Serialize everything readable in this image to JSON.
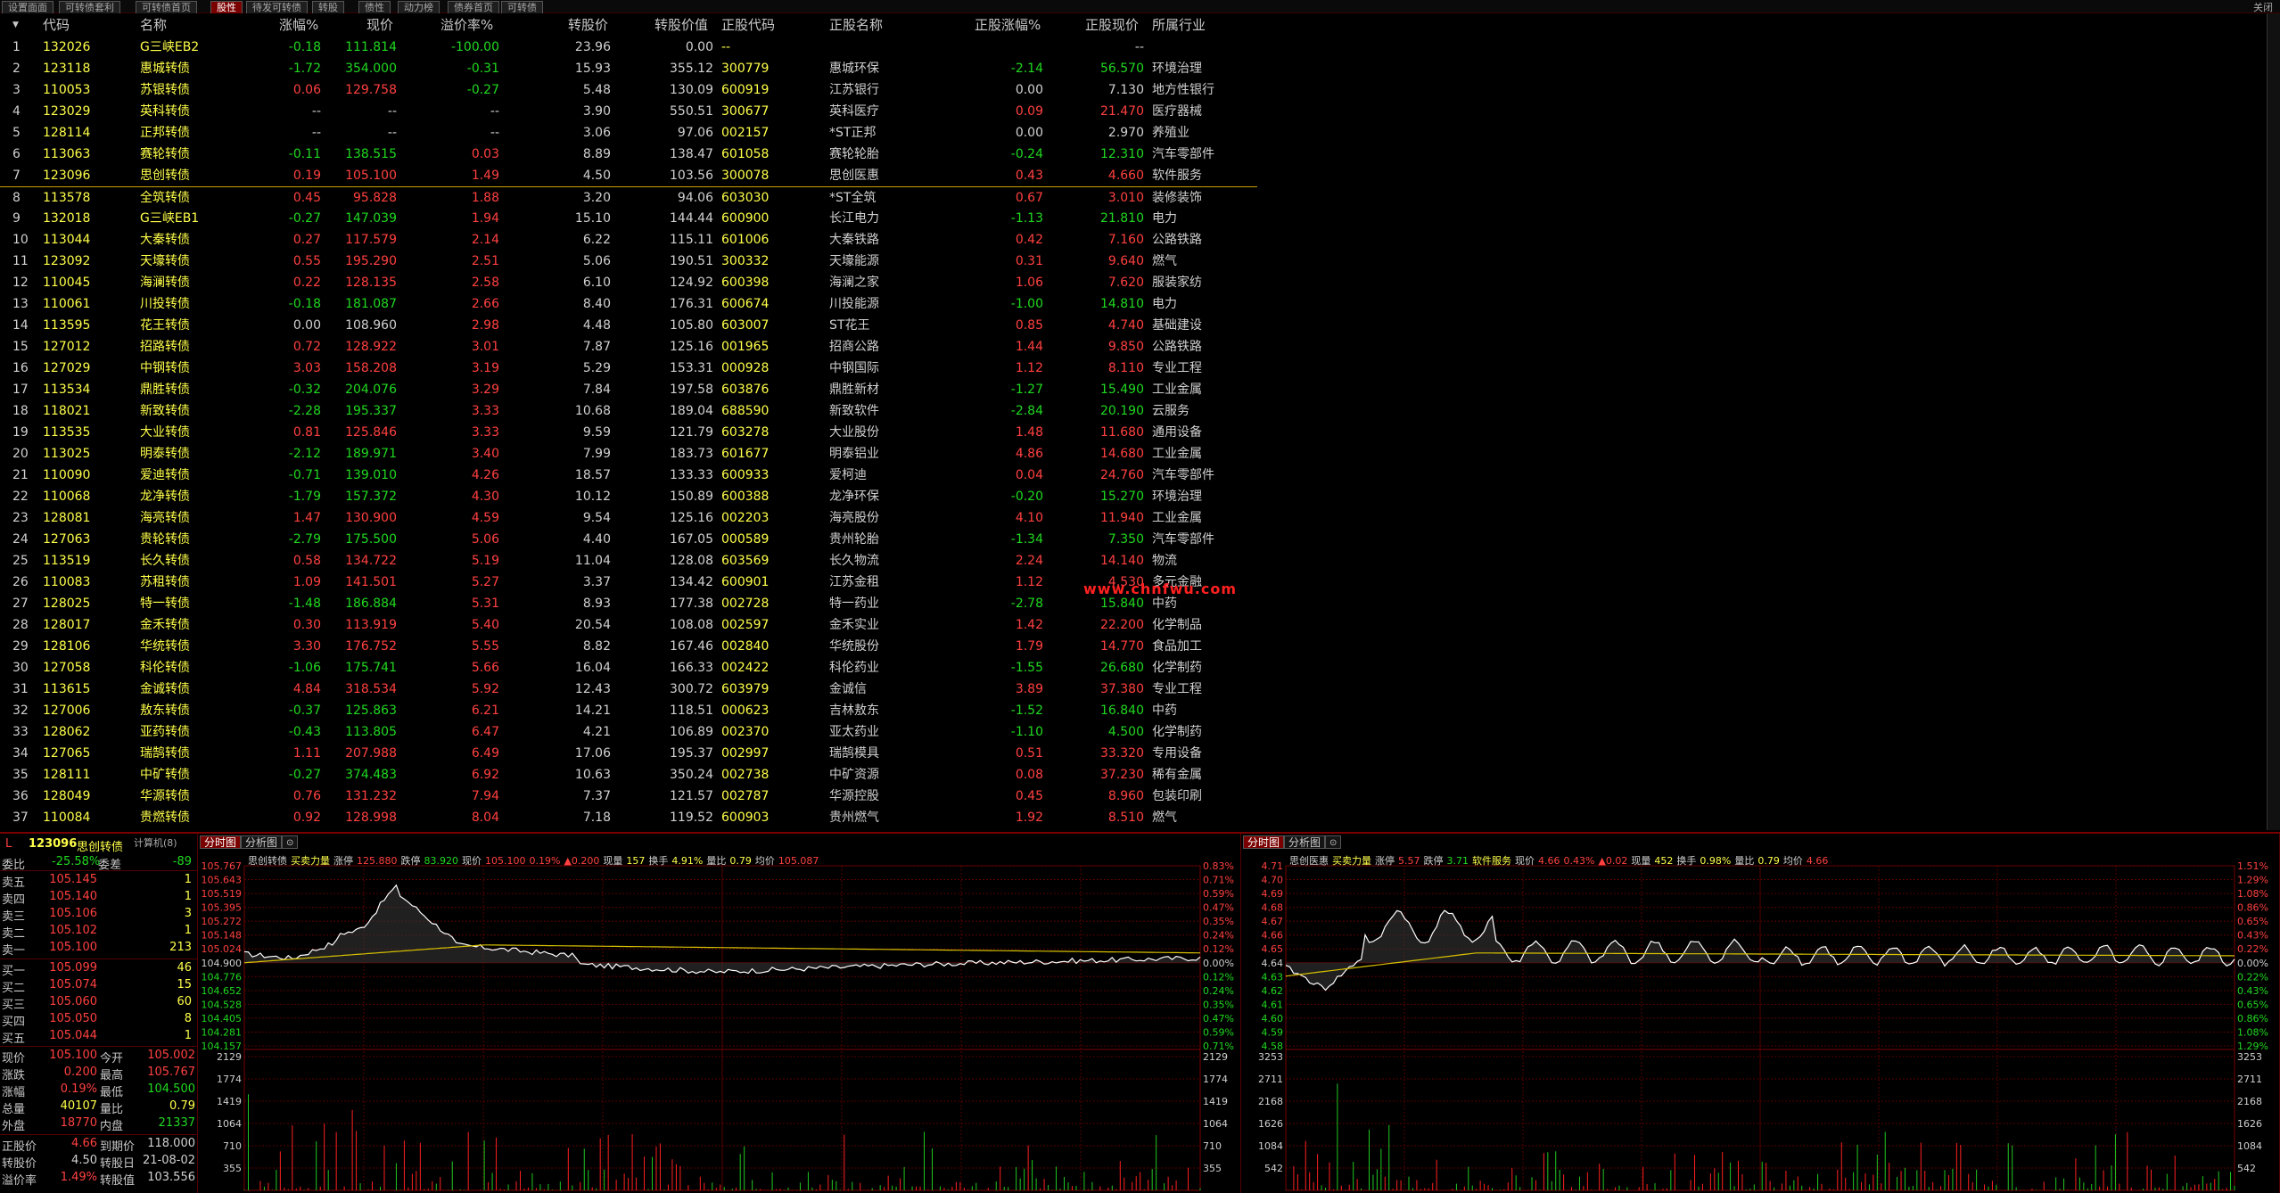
{
  "tabs": [
    "设置面面",
    "可转债套利",
    "可转债首页",
    "股性",
    "待发可转债",
    "转股",
    "债性",
    "动力榜",
    "债券首页",
    "可转债"
  ],
  "active_tab": 3,
  "close_label": "关闭",
  "headers": {
    "idx": "",
    "code": "代码",
    "name": "名称",
    "chg": "涨幅%",
    "price": "现价",
    "prem": "溢价率%",
    "conv_price": "转股价",
    "conv_value": "转股价值",
    "stock_code": "正股代码",
    "stock_name": "正股名称",
    "stock_chg": "正股涨幅%",
    "stock_price": "正股现价",
    "industry": "所属行业"
  },
  "rows": [
    [
      "1",
      "132026",
      "G三峡EB2",
      "-0.18",
      "111.814",
      "-100.00",
      "23.96",
      "0.00",
      "--",
      "",
      "",
      "--",
      ""
    ],
    [
      "2",
      "123118",
      "惠城转债",
      "-1.72",
      "354.000",
      "-0.31",
      "15.93",
      "355.12",
      "300779",
      "惠城环保",
      "-2.14",
      "56.570",
      "环境治理"
    ],
    [
      "3",
      "110053",
      "苏银转债",
      "0.06",
      "129.758",
      "-0.27",
      "5.48",
      "130.09",
      "600919",
      "江苏银行",
      "0.00",
      "7.130",
      "地方性银行"
    ],
    [
      "4",
      "123029",
      "英科转债",
      "--",
      "--",
      "--",
      "3.90",
      "550.51",
      "300677",
      "英科医疗",
      "0.09",
      "21.470",
      "医疗器械"
    ],
    [
      "5",
      "128114",
      "正邦转债",
      "--",
      "--",
      "--",
      "3.06",
      "97.06",
      "002157",
      "*ST正邦",
      "0.00",
      "2.970",
      "养殖业"
    ],
    [
      "6",
      "113063",
      "赛轮转债",
      "-0.11",
      "138.515",
      "0.03",
      "8.89",
      "138.47",
      "601058",
      "赛轮轮胎",
      "-0.24",
      "12.310",
      "汽车零部件"
    ],
    [
      "7",
      "123096",
      "思创转债",
      "0.19",
      "105.100",
      "1.49",
      "4.50",
      "103.56",
      "300078",
      "思创医惠",
      "0.43",
      "4.660",
      "软件服务"
    ],
    [
      "8",
      "113578",
      "全筑转债",
      "0.45",
      "95.828",
      "1.88",
      "3.20",
      "94.06",
      "603030",
      "*ST全筑",
      "0.67",
      "3.010",
      "装修装饰"
    ],
    [
      "9",
      "132018",
      "G三峡EB1",
      "-0.27",
      "147.039",
      "1.94",
      "15.10",
      "144.44",
      "600900",
      "长江电力",
      "-1.13",
      "21.810",
      "电力"
    ],
    [
      "10",
      "113044",
      "大秦转债",
      "0.27",
      "117.579",
      "2.14",
      "6.22",
      "115.11",
      "601006",
      "大秦铁路",
      "0.42",
      "7.160",
      "公路铁路"
    ],
    [
      "11",
      "123092",
      "天壕转债",
      "0.55",
      "195.290",
      "2.51",
      "5.06",
      "190.51",
      "300332",
      "天壕能源",
      "0.31",
      "9.640",
      "燃气"
    ],
    [
      "12",
      "110045",
      "海澜转债",
      "0.22",
      "128.135",
      "2.58",
      "6.10",
      "124.92",
      "600398",
      "海澜之家",
      "1.06",
      "7.620",
      "服装家纺"
    ],
    [
      "13",
      "110061",
      "川投转债",
      "-0.18",
      "181.087",
      "2.66",
      "8.40",
      "176.31",
      "600674",
      "川投能源",
      "-1.00",
      "14.810",
      "电力"
    ],
    [
      "14",
      "113595",
      "花王转债",
      "0.00",
      "108.960",
      "2.98",
      "4.48",
      "105.80",
      "603007",
      "ST花王",
      "0.85",
      "4.740",
      "基础建设"
    ],
    [
      "15",
      "127012",
      "招路转债",
      "0.72",
      "128.922",
      "3.01",
      "7.87",
      "125.16",
      "001965",
      "招商公路",
      "1.44",
      "9.850",
      "公路铁路"
    ],
    [
      "16",
      "127029",
      "中钢转债",
      "3.03",
      "158.208",
      "3.19",
      "5.29",
      "153.31",
      "000928",
      "中钢国际",
      "1.12",
      "8.110",
      "专业工程"
    ],
    [
      "17",
      "113534",
      "鼎胜转债",
      "-0.32",
      "204.076",
      "3.29",
      "7.84",
      "197.58",
      "603876",
      "鼎胜新材",
      "-1.27",
      "15.490",
      "工业金属"
    ],
    [
      "18",
      "118021",
      "新致转债",
      "-2.28",
      "195.337",
      "3.33",
      "10.68",
      "189.04",
      "688590",
      "新致软件",
      "-2.84",
      "20.190",
      "云服务"
    ],
    [
      "19",
      "113535",
      "大业转债",
      "0.81",
      "125.846",
      "3.33",
      "9.59",
      "121.79",
      "603278",
      "大业股份",
      "1.48",
      "11.680",
      "通用设备"
    ],
    [
      "20",
      "113025",
      "明泰转债",
      "-2.12",
      "189.971",
      "3.40",
      "7.99",
      "183.73",
      "601677",
      "明泰铝业",
      "4.86",
      "14.680",
      "工业金属"
    ],
    [
      "21",
      "110090",
      "爱迪转债",
      "-0.71",
      "139.010",
      "4.26",
      "18.57",
      "133.33",
      "600933",
      "爱柯迪",
      "0.04",
      "24.760",
      "汽车零部件"
    ],
    [
      "22",
      "110068",
      "龙净转债",
      "-1.79",
      "157.372",
      "4.30",
      "10.12",
      "150.89",
      "600388",
      "龙净环保",
      "-0.20",
      "15.270",
      "环境治理"
    ],
    [
      "23",
      "128081",
      "海亮转债",
      "1.47",
      "130.900",
      "4.59",
      "9.54",
      "125.16",
      "002203",
      "海亮股份",
      "4.10",
      "11.940",
      "工业金属"
    ],
    [
      "24",
      "127063",
      "贵轮转债",
      "-2.79",
      "175.500",
      "5.06",
      "4.40",
      "167.05",
      "000589",
      "贵州轮胎",
      "-1.34",
      "7.350",
      "汽车零部件"
    ],
    [
      "25",
      "113519",
      "长久转债",
      "0.58",
      "134.722",
      "5.19",
      "11.04",
      "128.08",
      "603569",
      "长久物流",
      "2.24",
      "14.140",
      "物流"
    ],
    [
      "26",
      "110083",
      "苏租转债",
      "1.09",
      "141.501",
      "5.27",
      "3.37",
      "134.42",
      "600901",
      "江苏金租",
      "1.12",
      "4.530",
      "多元金融"
    ],
    [
      "27",
      "128025",
      "特一转债",
      "-1.48",
      "186.884",
      "5.31",
      "8.93",
      "177.38",
      "002728",
      "特一药业",
      "-2.78",
      "15.840",
      "中药"
    ],
    [
      "28",
      "128017",
      "金禾转债",
      "0.30",
      "113.919",
      "5.40",
      "20.54",
      "108.08",
      "002597",
      "金禾实业",
      "1.42",
      "22.200",
      "化学制品"
    ],
    [
      "29",
      "128106",
      "华统转债",
      "3.30",
      "176.752",
      "5.55",
      "8.82",
      "167.46",
      "002840",
      "华统股份",
      "1.79",
      "14.770",
      "食品加工"
    ],
    [
      "30",
      "127058",
      "科伦转债",
      "-1.06",
      "175.741",
      "5.66",
      "16.04",
      "166.33",
      "002422",
      "科伦药业",
      "-1.55",
      "26.680",
      "化学制药"
    ],
    [
      "31",
      "113615",
      "金诚转债",
      "4.84",
      "318.534",
      "5.92",
      "12.43",
      "300.72",
      "603979",
      "金诚信",
      "3.89",
      "37.380",
      "专业工程"
    ],
    [
      "32",
      "127006",
      "敖东转债",
      "-0.37",
      "125.863",
      "6.21",
      "14.21",
      "118.51",
      "000623",
      "吉林敖东",
      "-1.52",
      "16.840",
      "中药"
    ],
    [
      "33",
      "128062",
      "亚药转债",
      "-0.43",
      "113.805",
      "6.47",
      "4.21",
      "106.89",
      "002370",
      "亚太药业",
      "-1.10",
      "4.500",
      "化学制药"
    ],
    [
      "34",
      "127065",
      "瑞鹄转债",
      "1.11",
      "207.988",
      "6.49",
      "17.06",
      "195.37",
      "002997",
      "瑞鹄模具",
      "0.51",
      "33.320",
      "专用设备"
    ],
    [
      "35",
      "128111",
      "中矿转债",
      "-0.27",
      "374.483",
      "6.92",
      "10.63",
      "350.24",
      "002738",
      "中矿资源",
      "0.08",
      "37.230",
      "稀有金属"
    ],
    [
      "36",
      "128049",
      "华源转债",
      "0.76",
      "131.232",
      "7.94",
      "7.37",
      "121.57",
      "002787",
      "华源控股",
      "0.45",
      "8.960",
      "包装印刷"
    ],
    [
      "37",
      "110084",
      "贵燃转债",
      "0.92",
      "128.998",
      "8.04",
      "7.18",
      "119.52",
      "600903",
      "贵州燃气",
      "1.92",
      "8.510",
      "燃气"
    ]
  ],
  "watermark": "www.chnfwu.com",
  "quote": {
    "head_flag": "L",
    "code": "123096",
    "name": "思创转债",
    "calc": "计算机(8)",
    "weibi_label": "委比",
    "weibi": "-25.58%",
    "weicha_label": "委差",
    "weicha": "-89",
    "sells": [
      [
        "卖五",
        "105.145",
        "1"
      ],
      [
        "卖四",
        "105.140",
        "1"
      ],
      [
        "卖三",
        "105.106",
        "3"
      ],
      [
        "卖二",
        "105.102",
        "1"
      ],
      [
        "卖一",
        "105.100",
        "213"
      ]
    ],
    "buys": [
      [
        "买一",
        "105.099",
        "46"
      ],
      [
        "买二",
        "105.074",
        "15"
      ],
      [
        "买三",
        "105.060",
        "60"
      ],
      [
        "买四",
        "105.050",
        "8"
      ],
      [
        "买五",
        "105.044",
        "1"
      ]
    ],
    "stats": [
      [
        "现价",
        "105.100",
        "今开",
        "105.002"
      ],
      [
        "涨跌",
        "0.200",
        "最高",
        "105.767"
      ],
      [
        "涨幅",
        "0.19%",
        "最低",
        "104.500"
      ],
      [
        "总量",
        "40107",
        "量比",
        "0.79"
      ],
      [
        "外盘",
        "18770",
        "内盘",
        "21337"
      ]
    ],
    "extra": [
      [
        "正股价",
        "4.66",
        "到期价",
        "118.000"
      ],
      [
        "转股价",
        "4.50",
        "转股日",
        "21-08-02"
      ],
      [
        "溢价率",
        "1.49%",
        "转股值",
        "103.556"
      ]
    ]
  },
  "chart1": {
    "tab_active": "分时图",
    "tab2": "分析图",
    "info": {
      "name": "思创转债",
      "mm": "买卖力量",
      "zt": "涨停",
      "zt_v": "125.880",
      "dt": "跌停",
      "dt_v": "83.920",
      "xj": "现价",
      "xj_v": "105.100",
      "chg": "0.19%",
      "delta": "▲0.200",
      "xl": "现量",
      "xl_v": "157",
      "hs": "换手",
      "hs_v": "4.91%",
      "lb": "量比",
      "lb_v": "0.79",
      "jj": "均价",
      "jj_v": "105.087"
    },
    "left_labels": [
      "105.767",
      "105.643",
      "105.519",
      "105.395",
      "105.272",
      "105.148",
      "105.024",
      "104.900",
      "104.776",
      "104.652",
      "104.528",
      "104.405",
      "104.281",
      "104.157"
    ],
    "right_labels": [
      "0.83%",
      "0.71%",
      "0.59%",
      "0.47%",
      "0.35%",
      "0.24%",
      "0.12%",
      "0.00%",
      "0.12%",
      "0.24%",
      "0.35%",
      "0.47%",
      "0.59%",
      "0.71%"
    ],
    "vol_labels": [
      "2129",
      "1774",
      "1419",
      "1064",
      "710",
      "355"
    ]
  },
  "chart2": {
    "tab_active": "分时图",
    "tab2": "分析图",
    "info": {
      "name": "思创医惠",
      "mm": "买卖力量",
      "zt": "涨停",
      "zt_v": "5.57",
      "dt": "跌停",
      "dt_v": "3.71",
      "ind": "软件服务",
      "xj": "现价",
      "xj_v": "4.66",
      "chg": "0.43%",
      "delta": "▲0.02",
      "xl": "现量",
      "xl_v": "452",
      "hs": "换手",
      "hs_v": "0.98%",
      "lb": "量比",
      "lb_v": "0.79",
      "jj": "均价",
      "jj_v": "4.66"
    },
    "left_labels": [
      "4.71",
      "4.70",
      "4.69",
      "4.68",
      "4.67",
      "4.66",
      "4.65",
      "4.64",
      "4.63",
      "4.62",
      "4.61",
      "4.60",
      "4.59",
      "4.58"
    ],
    "right_labels": [
      "1.51%",
      "1.29%",
      "1.08%",
      "0.86%",
      "0.65%",
      "0.43%",
      "0.22%",
      "0.00%",
      "0.22%",
      "0.43%",
      "0.65%",
      "0.86%",
      "1.08%",
      "1.29%"
    ],
    "vol_labels": [
      "3253",
      "2711",
      "2168",
      "1626",
      "1084",
      "542"
    ]
  },
  "colors": {
    "up": "#ff4040",
    "down": "#20d820",
    "flat": "#d0d0d0",
    "code": "#ffff4a",
    "accent": "#7a0000",
    "grid": "#6a0000",
    "avg": "#d8c000"
  }
}
